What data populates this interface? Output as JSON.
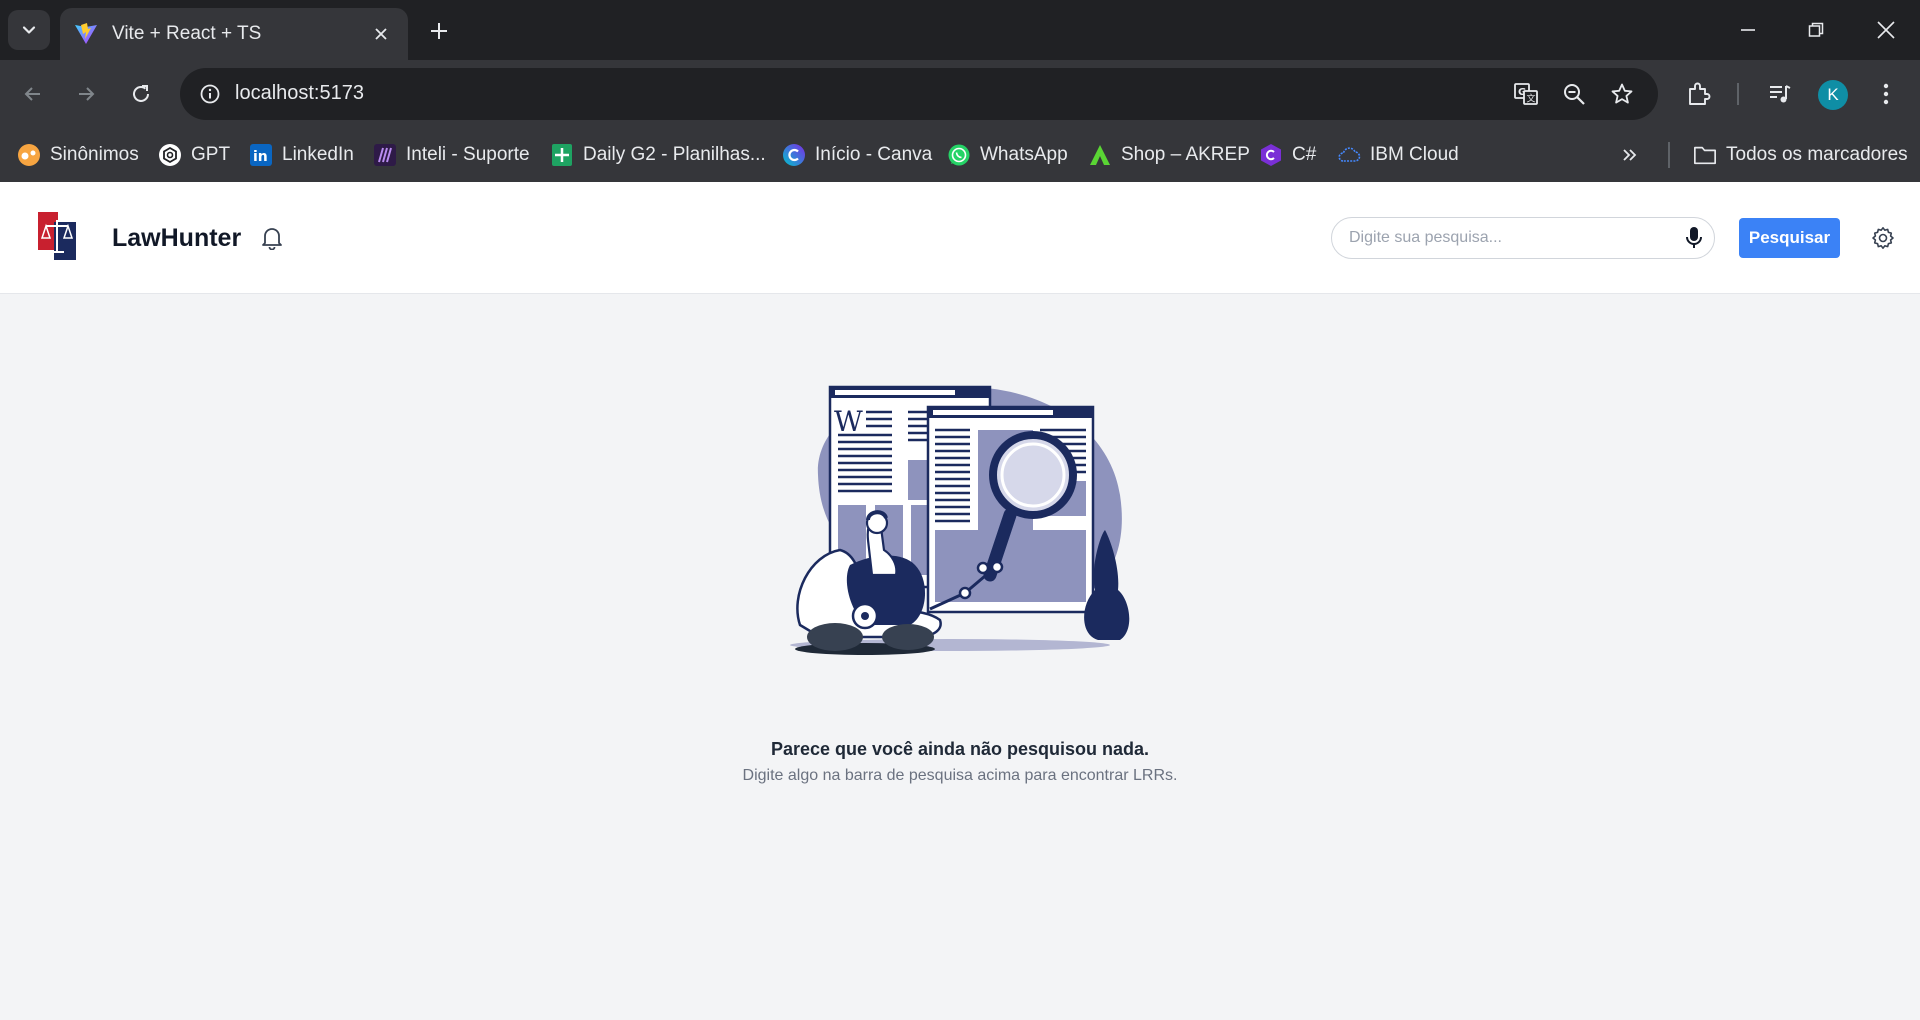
{
  "browser": {
    "tab_title": "Vite + React + TS",
    "url": "localhost:5173",
    "profile_initial": "K",
    "bookmarks": [
      {
        "label": "Sinônimos",
        "icon": "sinonimos-icon"
      },
      {
        "label": "GPT",
        "icon": "gpt-icon"
      },
      {
        "label": "LinkedIn",
        "icon": "linkedin-icon"
      },
      {
        "label": "Inteli - Suporte",
        "icon": "inteli-icon"
      },
      {
        "label": "Daily G2 - Planilhas...",
        "icon": "sheets-icon"
      },
      {
        "label": "Início - Canva",
        "icon": "canva-icon"
      },
      {
        "label": "WhatsApp",
        "icon": "whatsapp-icon"
      },
      {
        "label": "Shop – AKREP",
        "icon": "akrep-icon"
      },
      {
        "label": "C#",
        "icon": "csharp-icon"
      },
      {
        "label": "IBM Cloud",
        "icon": "ibm-cloud-icon"
      }
    ],
    "all_bookmarks_label": "Todos os marcadores"
  },
  "app": {
    "brand": "LawHunter",
    "search_placeholder": "Digite sua pesquisa...",
    "search_button": "Pesquisar",
    "empty_title": "Parece que você ainda não pesquisou nada.",
    "empty_subtitle": "Digite algo na barra de pesquisa acima para encontrar LRRs.",
    "illustration_letter": "W"
  },
  "colors": {
    "accent": "#3b82f6",
    "chrome_dark": "#202124",
    "chrome_mid": "#35363a",
    "illustration_navy": "#1b2a5e",
    "illustration_lavender": "#8e93bd"
  }
}
